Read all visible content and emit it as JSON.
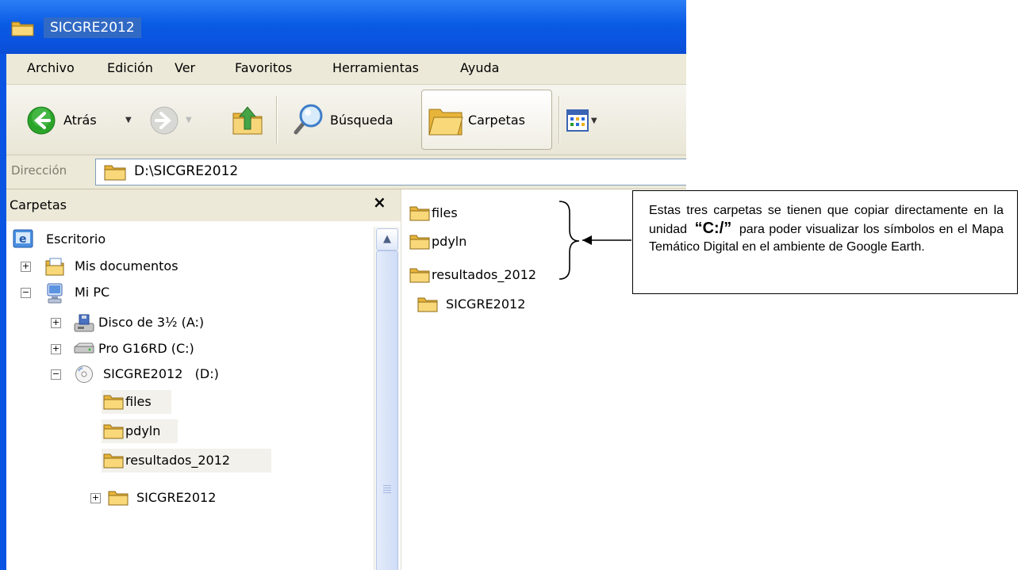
{
  "window": {
    "title": "SICGRE2012"
  },
  "menu": [
    {
      "label": "Archivo"
    },
    {
      "label": "Edición"
    },
    {
      "label": "Ver"
    },
    {
      "label": "Favoritos"
    },
    {
      "label": "Herramientas"
    },
    {
      "label": "Ayuda"
    }
  ],
  "toolbar": {
    "back_label": "Atrás",
    "search_label": "Búsqueda",
    "folders_label": "Carpetas"
  },
  "address": {
    "label": "Dirección",
    "value": "D:\\SICGRE2012"
  },
  "folder_pane": {
    "title": "Carpetas",
    "tree": {
      "desktop": "Escritorio",
      "my_documents": "Mis documentos",
      "my_pc": "Mi PC",
      "floppy": "Disco de 3½ (A:)",
      "drive_c": "Pro G16RD (C:)",
      "drive_d": "SICGRE2012   (D:)",
      "files": "files",
      "pdyln": "pdyln",
      "resultados": "resultados_2012",
      "sicgre": "SICGRE2012"
    }
  },
  "content": {
    "items": [
      "files",
      "pdyln",
      "resultados_2012",
      "SICGRE2012"
    ]
  },
  "callout": {
    "text_before": "Estas tres carpetas se tienen que copiar directamente en la unidad",
    "drive": "“C:/”",
    "text_after": "para poder visualizar los símbolos en el Mapa Temático Digital en el ambiente de Google Earth."
  },
  "colors": {
    "titlebar": "#0a54e3",
    "chrome": "#ece9d8",
    "selection": "#316ac5",
    "folder": "#f0c64a"
  },
  "icons": [
    "folder-icon",
    "back-icon",
    "forward-icon",
    "up-icon",
    "search-icon",
    "views-icon",
    "desktop-icon",
    "documents-icon",
    "computer-icon",
    "floppy-icon",
    "hard-drive-icon",
    "cd-drive-icon"
  ]
}
